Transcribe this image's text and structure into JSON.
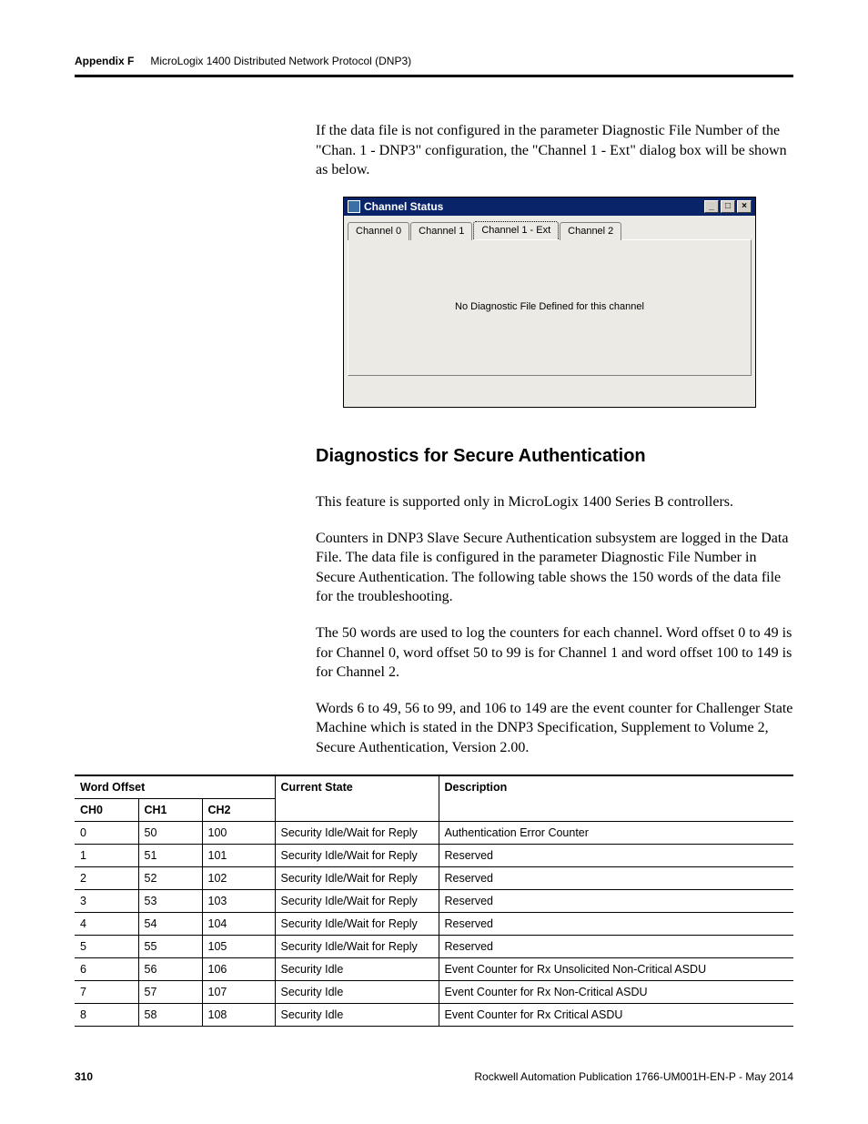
{
  "header": {
    "appendix": "Appendix F",
    "title": "MicroLogix 1400 Distributed Network Protocol (DNP3)"
  },
  "intro_para": "If the data file is not configured in the parameter Diagnostic File Number of the \"Chan. 1 - DNP3\" configuration, the \"Channel 1 - Ext\" dialog box will be shown as below.",
  "dialog": {
    "title": "Channel Status",
    "tabs": [
      "Channel 0",
      "Channel 1",
      "Channel 1 - Ext",
      "Channel 2"
    ],
    "active_tab_index": 2,
    "pane_message": "No Diagnostic File Defined for this channel"
  },
  "section": {
    "heading": "Diagnostics for Secure Authentication",
    "p1": "This feature is supported only in MicroLogix 1400 Series B controllers.",
    "p2": "Counters in DNP3 Slave Secure Authentication subsystem are logged in the Data File. The data file is configured in the parameter Diagnostic File Number in Secure Authentication. The following table shows the 150 words of the data file for the troubleshooting.",
    "p3": "The 50 words are used to log the counters for each channel. Word offset 0 to 49 is for Channel 0, word offset 50 to 99 is for Channel 1 and word offset 100 to 149 is for Channel 2.",
    "p4": "Words 6 to 49, 56 to 99, and 106 to 149 are the event counter for Challenger State Machine which is stated in the DNP3 Specification, Supplement to Volume 2, Secure Authentication, Version 2.00."
  },
  "table": {
    "headers": {
      "word_offset": "Word Offset",
      "ch0": "CH0",
      "ch1": "CH1",
      "ch2": "CH2",
      "current_state": "Current State",
      "description": "Description"
    },
    "rows": [
      {
        "ch0": "0",
        "ch1": "50",
        "ch2": "100",
        "state": "Security Idle/Wait for Reply",
        "desc": "Authentication Error Counter"
      },
      {
        "ch0": "1",
        "ch1": "51",
        "ch2": "101",
        "state": "Security Idle/Wait for Reply",
        "desc": "Reserved"
      },
      {
        "ch0": "2",
        "ch1": "52",
        "ch2": "102",
        "state": "Security Idle/Wait for Reply",
        "desc": "Reserved"
      },
      {
        "ch0": "3",
        "ch1": "53",
        "ch2": "103",
        "state": "Security Idle/Wait for Reply",
        "desc": "Reserved"
      },
      {
        "ch0": "4",
        "ch1": "54",
        "ch2": "104",
        "state": "Security Idle/Wait for Reply",
        "desc": "Reserved"
      },
      {
        "ch0": "5",
        "ch1": "55",
        "ch2": "105",
        "state": "Security Idle/Wait for Reply",
        "desc": "Reserved"
      },
      {
        "ch0": "6",
        "ch1": "56",
        "ch2": "106",
        "state": "Security Idle",
        "desc": "Event Counter for Rx Unsolicited Non-Critical ASDU"
      },
      {
        "ch0": "7",
        "ch1": "57",
        "ch2": "107",
        "state": "Security Idle",
        "desc": "Event Counter for Rx Non-Critical ASDU"
      },
      {
        "ch0": "8",
        "ch1": "58",
        "ch2": "108",
        "state": "Security Idle",
        "desc": "Event Counter for Rx Critical ASDU"
      }
    ]
  },
  "footer": {
    "page_number": "310",
    "pub": "Rockwell Automation Publication 1766-UM001H-EN-P - May 2014"
  }
}
